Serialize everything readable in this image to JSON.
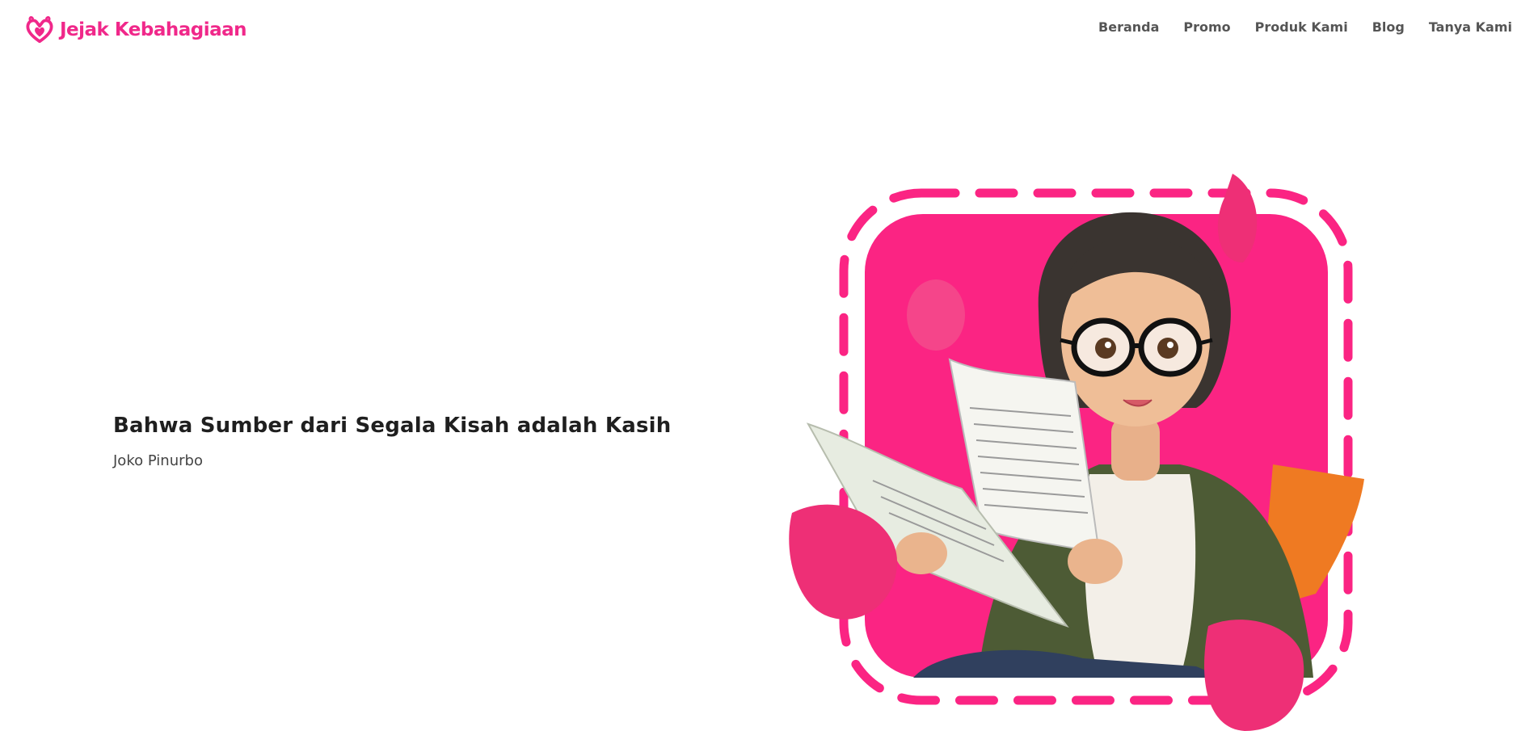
{
  "brand": {
    "name": "Jejak Kebahagiaan",
    "logo_icon": "heart-flame-icon",
    "color": "#f0288a"
  },
  "nav": {
    "items": [
      {
        "label": "Beranda"
      },
      {
        "label": "Promo"
      },
      {
        "label": "Produk Kami"
      },
      {
        "label": "Blog"
      },
      {
        "label": "Tanya Kami"
      }
    ]
  },
  "hero": {
    "quote": "Bahwa Sumber dari Segala Kisah adalah Kasih",
    "author": "Joko Pinurbo",
    "illustration": "woman-reading-newspaper-illustration",
    "frame_color": "#fb2483",
    "petal_color": "#ee2f76"
  }
}
